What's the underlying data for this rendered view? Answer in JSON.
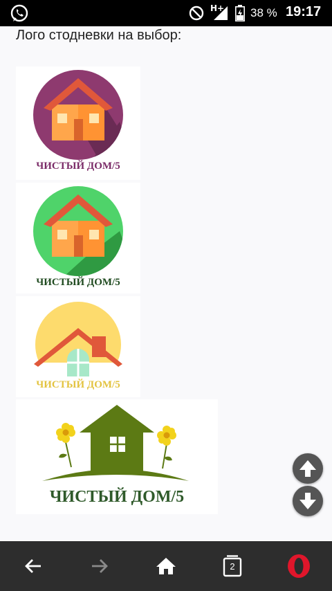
{
  "status_bar": {
    "network_label": "H+",
    "battery_percent": "38 %",
    "time": "19:17",
    "icons": [
      "whatsapp-icon",
      "do-not-disturb-icon",
      "signal-icon",
      "battery-icon"
    ]
  },
  "page": {
    "heading": "Лого стодневки на выбор:"
  },
  "logos": [
    {
      "caption": "ЧИСТЫЙ ДОМ/5",
      "circle_color": "#8e3a6f",
      "caption_color": "#7a2a67"
    },
    {
      "caption": "ЧИСТЫЙ ДОМ/5",
      "circle_color": "#4fd36a",
      "caption_color": "#1f4a1f"
    },
    {
      "caption": "ЧИСТЫЙ ДОМ/5",
      "circle_color": "#fddb6d",
      "caption_color": "#e3c33f"
    },
    {
      "caption": "ЧИСТЫЙ ДОМ/5",
      "circle_color": "#5c7a14",
      "caption_color": "#2f5a2a"
    }
  ],
  "scroll_buttons": {
    "up_icon": "arrow-up-icon",
    "down_icon": "arrow-down-icon"
  },
  "bottom_nav": {
    "tab_count": "2",
    "icons": [
      "back-arrow-icon",
      "forward-arrow-icon",
      "home-icon",
      "tabs-icon",
      "opera-icon"
    ]
  },
  "colors": {
    "status_bar_bg": "#000000",
    "nav_bg": "#2d2d2d",
    "house_orange": "#ffa64b",
    "roof_red": "#e0583a",
    "opera_red": "#e0162b"
  }
}
